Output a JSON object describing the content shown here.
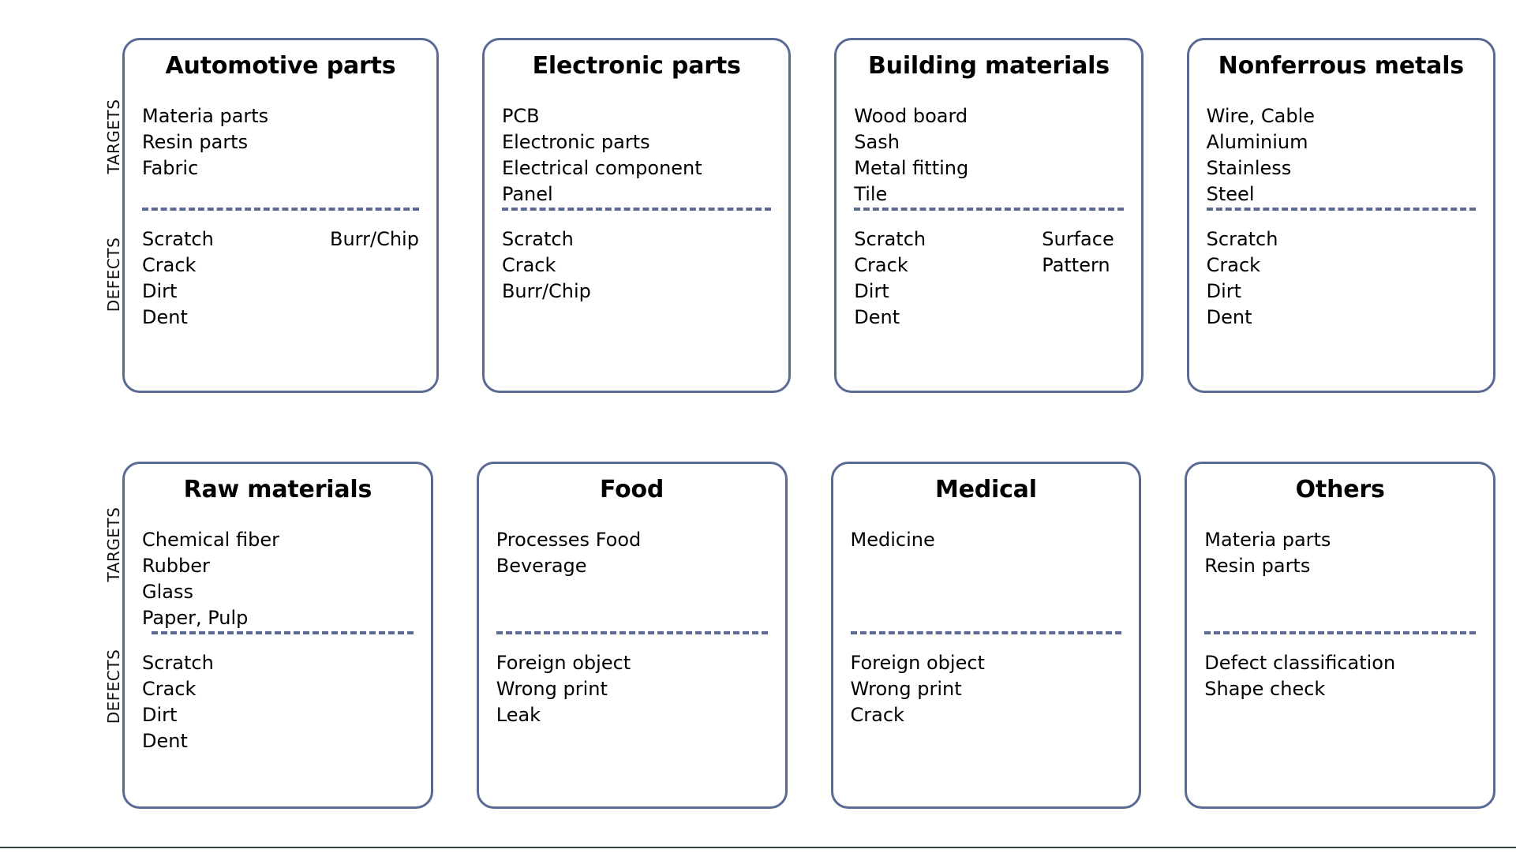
{
  "meta": {
    "accent_color": "#5a6a93",
    "text_color": "#000000",
    "bottom_rule_color": "#2f4a39",
    "background": "#ffffff"
  },
  "axis": {
    "targets_label": "TARGETS",
    "defects_label": "DEFECTS"
  },
  "rows": [
    {
      "cards": [
        {
          "title": "Automotive parts",
          "targets": [
            {
              "left": "Materia parts",
              "right": ""
            },
            {
              "left": "Resin parts",
              "right": ""
            },
            {
              "left": "Fabric",
              "right": ""
            }
          ],
          "defects": [
            {
              "left": "Scratch",
              "right": "Burr/Chip"
            },
            {
              "left": "Crack",
              "right": ""
            },
            {
              "left": "Dirt",
              "right": ""
            },
            {
              "left": "Dent",
              "right": ""
            }
          ]
        },
        {
          "title": "Electronic parts",
          "targets": [
            {
              "left": "PCB",
              "right": ""
            },
            {
              "left": "Electronic parts",
              "right": ""
            },
            {
              "left": "Electrical component",
              "right": ""
            },
            {
              "left": "Panel",
              "right": ""
            }
          ],
          "defects": [
            {
              "left": "Scratch",
              "right": ""
            },
            {
              "left": "Crack",
              "right": ""
            },
            {
              "left": "Burr/Chip",
              "right": ""
            }
          ]
        },
        {
          "title": "Building materials",
          "targets": [
            {
              "left": "Wood board",
              "right": ""
            },
            {
              "left": "Sash",
              "right": ""
            },
            {
              "left": "Metal fitting",
              "right": ""
            },
            {
              "left": "Tile",
              "right": ""
            }
          ],
          "defects": [
            {
              "left": "Scratch",
              "right": "Surface"
            },
            {
              "left": "Crack",
              "right": "Pattern"
            },
            {
              "left": "Dirt",
              "right": ""
            },
            {
              "left": "Dent",
              "right": ""
            }
          ]
        },
        {
          "title": "Nonferrous metals",
          "targets": [
            {
              "left": "Wire, Cable",
              "right": ""
            },
            {
              "left": "Aluminium",
              "right": ""
            },
            {
              "left": "Stainless",
              "right": ""
            },
            {
              "left": "Steel",
              "right": ""
            }
          ],
          "defects": [
            {
              "left": "Scratch",
              "right": ""
            },
            {
              "left": "Crack",
              "right": ""
            },
            {
              "left": "Dirt",
              "right": ""
            },
            {
              "left": "Dent",
              "right": ""
            }
          ]
        }
      ]
    },
    {
      "cards": [
        {
          "title": "Raw materials",
          "targets": [
            {
              "left": "Chemical fiber",
              "right": ""
            },
            {
              "left": "Rubber",
              "right": ""
            },
            {
              "left": "Glass",
              "right": ""
            },
            {
              "left": "Paper, Pulp",
              "right": ""
            }
          ],
          "defects": [
            {
              "left": "Scratch",
              "right": ""
            },
            {
              "left": "Crack",
              "right": ""
            },
            {
              "left": "Dirt",
              "right": ""
            },
            {
              "left": "Dent",
              "right": ""
            }
          ]
        },
        {
          "title": "Food",
          "targets": [
            {
              "left": "Processes Food",
              "right": ""
            },
            {
              "left": "Beverage",
              "right": ""
            }
          ],
          "defects": [
            {
              "left": "Foreign object",
              "right": ""
            },
            {
              "left": "Wrong print",
              "right": ""
            },
            {
              "left": "Leak",
              "right": ""
            }
          ]
        },
        {
          "title": "Medical",
          "targets": [
            {
              "left": "Medicine",
              "right": ""
            }
          ],
          "defects": [
            {
              "left": "Foreign object",
              "right": ""
            },
            {
              "left": "Wrong print",
              "right": ""
            },
            {
              "left": "Crack",
              "right": ""
            }
          ]
        },
        {
          "title": "Others",
          "targets": [
            {
              "left": "Materia parts",
              "right": ""
            },
            {
              "left": "Resin parts",
              "right": ""
            }
          ],
          "defects": [
            {
              "left": "Defect classification",
              "right": ""
            },
            {
              "left": "Shape check",
              "right": ""
            }
          ]
        }
      ]
    }
  ]
}
